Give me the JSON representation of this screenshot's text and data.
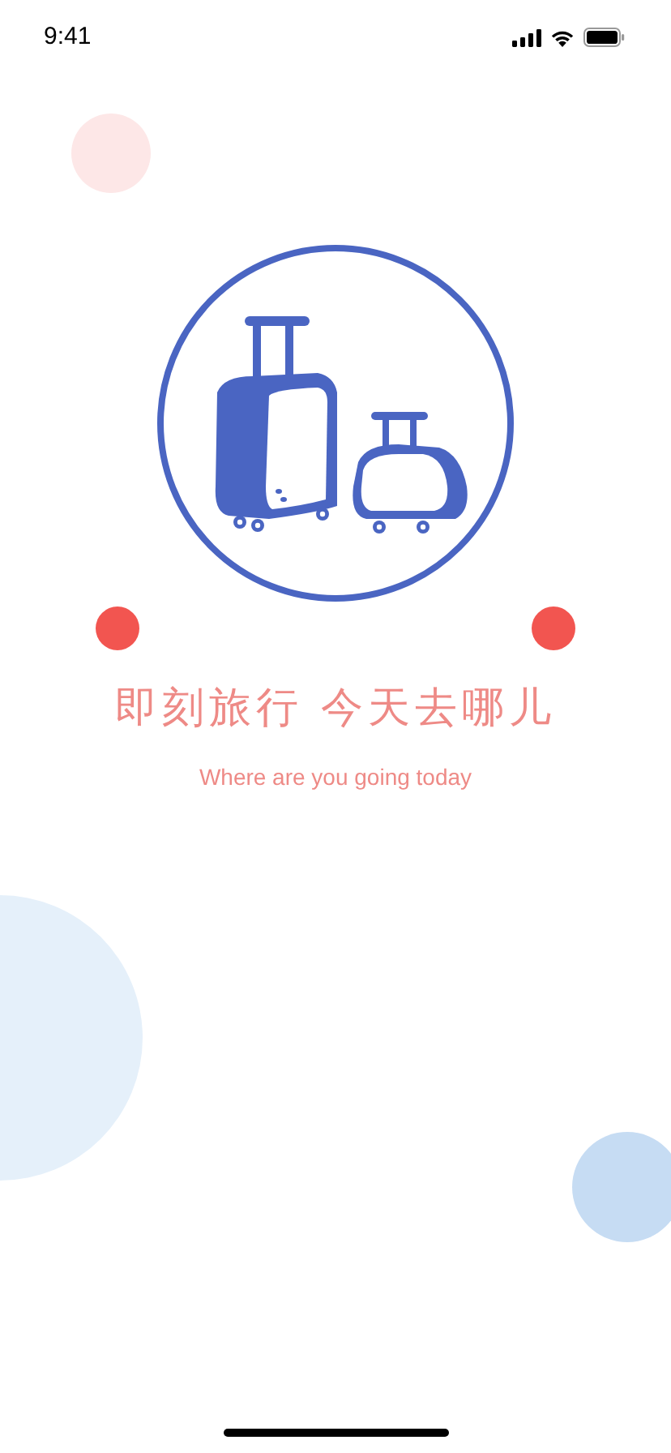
{
  "status_bar": {
    "time": "9:41"
  },
  "title": "即刻旅行 今天去哪儿",
  "subtitle": "Where are you going today"
}
